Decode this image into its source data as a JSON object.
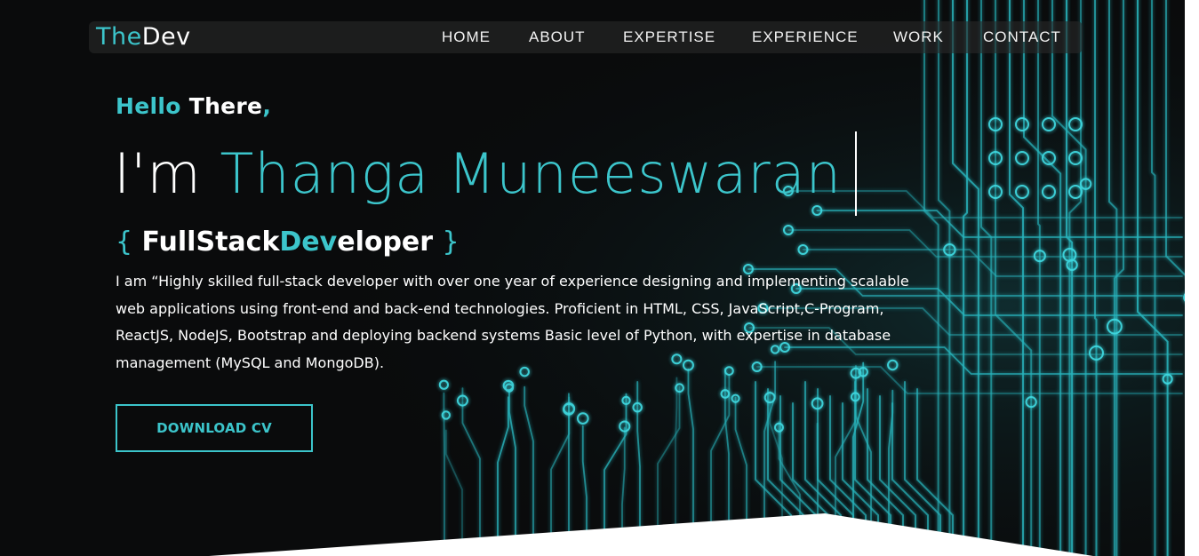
{
  "brand": {
    "logo_prefix": "The",
    "logo_suffix": "Dev"
  },
  "nav": {
    "items": [
      "HOME",
      "ABOUT",
      "EXPERTISE",
      "EXPERIENCE",
      "WORK",
      "CONTACT"
    ]
  },
  "hero": {
    "greeting_hello": "Hello",
    "greeting_there": "There",
    "greeting_comma": ",",
    "intro": "I'm",
    "name": "Thanga Muneeswaran",
    "role_open_brace": "{",
    "role_part1": "FullStack",
    "role_part2": "Dev",
    "role_part3": "eloper",
    "role_close_brace": "}",
    "bio": "I am “Highly skilled full-stack developer with over one year of experience designing and implementing scalable web applications using front-end and back-end technologies. Proficient in HTML, CSS, JavaScript,C-Program, ReactJS, NodeJS, Bootstrap and deploying backend systems Basic level of Python, with expertise in database management (MySQL and MongoDB).",
    "cta_label": "DOWNLOAD CV"
  },
  "colors": {
    "accent": "#3cc5cb",
    "background": "#0a0b0c",
    "text": "#ffffff"
  },
  "decoration": {
    "background_art": "circuit-board-illustration"
  }
}
